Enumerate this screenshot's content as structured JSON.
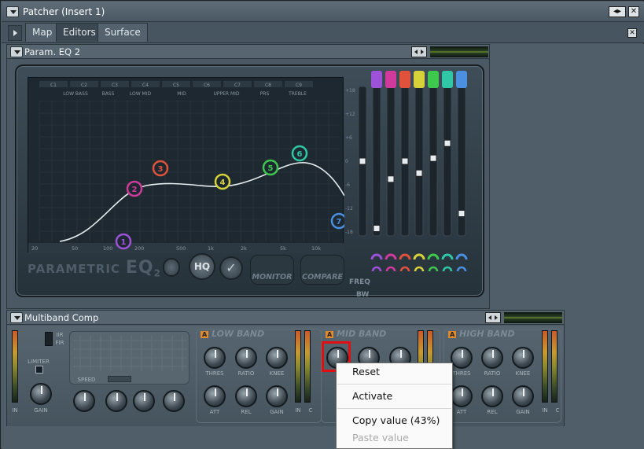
{
  "window": {
    "title": "Patcher (Insert 1)"
  },
  "tabs": [
    {
      "label": "Map"
    },
    {
      "label": "Editors"
    },
    {
      "label": "Surface"
    }
  ],
  "eq": {
    "title": "Param. EQ 2",
    "brand": "PARAMETRIC",
    "brand_suffix": "EQ",
    "brand_num": "2",
    "hq_label": "HQ",
    "monitor_label": "MONITOR",
    "compare_label": "COMPARE",
    "freq_label": "FREQ",
    "bw_label": "BW",
    "note_row": [
      "C1",
      "C2",
      "C3",
      "C4",
      "C5",
      "C6",
      "C7",
      "C8",
      "C9"
    ],
    "range_row": [
      "LOW BASS",
      "BASS",
      "LOW MID",
      "MID",
      "UPPER MID",
      "PRS",
      "TREBLE"
    ],
    "freq_ticks": [
      "20",
      "50",
      "100",
      "200",
      "500",
      "1k",
      "2k",
      "5k",
      "10k"
    ],
    "db_ticks": [
      "+18",
      "+12",
      "+6",
      "0",
      "-6",
      "-12",
      "-18"
    ],
    "bands": [
      {
        "num": "1",
        "color": "#9d52d9"
      },
      {
        "num": "2",
        "color": "#d03a9c"
      },
      {
        "num": "3",
        "color": "#e0523b"
      },
      {
        "num": "4",
        "color": "#d7d23a"
      },
      {
        "num": "5",
        "color": "#3ec84e"
      },
      {
        "num": "6",
        "color": "#2fc7a6"
      },
      {
        "num": "7",
        "color": "#4a8fe0"
      }
    ],
    "slider_levels": [
      0.5,
      0.05,
      0.38,
      0.5,
      0.42,
      0.52,
      0.62,
      0.15
    ]
  },
  "multiband": {
    "title": "Multiband Comp",
    "mode_iir": "IIR",
    "mode_fir": "FIR",
    "limiter_label": "LIMITER",
    "speed_label": "SPEED",
    "gain_label": "GAIN",
    "sections": [
      {
        "name": "LOW BAND"
      },
      {
        "name": "MID BAND"
      },
      {
        "name": "HIGH BAND"
      }
    ],
    "knob_labels": {
      "thres": "THRES",
      "ratio": "RATIO",
      "knee": "KNEE",
      "att": "ATT",
      "rel": "REL",
      "gain": "GAIN"
    },
    "in_label": "IN",
    "c_label": "C"
  },
  "context_menu": {
    "items": [
      {
        "label": "Reset",
        "enabled": true
      },
      {
        "label": "Activate",
        "enabled": true
      },
      {
        "label": "Copy value (43%)",
        "enabled": true
      },
      {
        "label": "Paste value",
        "enabled": false
      }
    ]
  }
}
